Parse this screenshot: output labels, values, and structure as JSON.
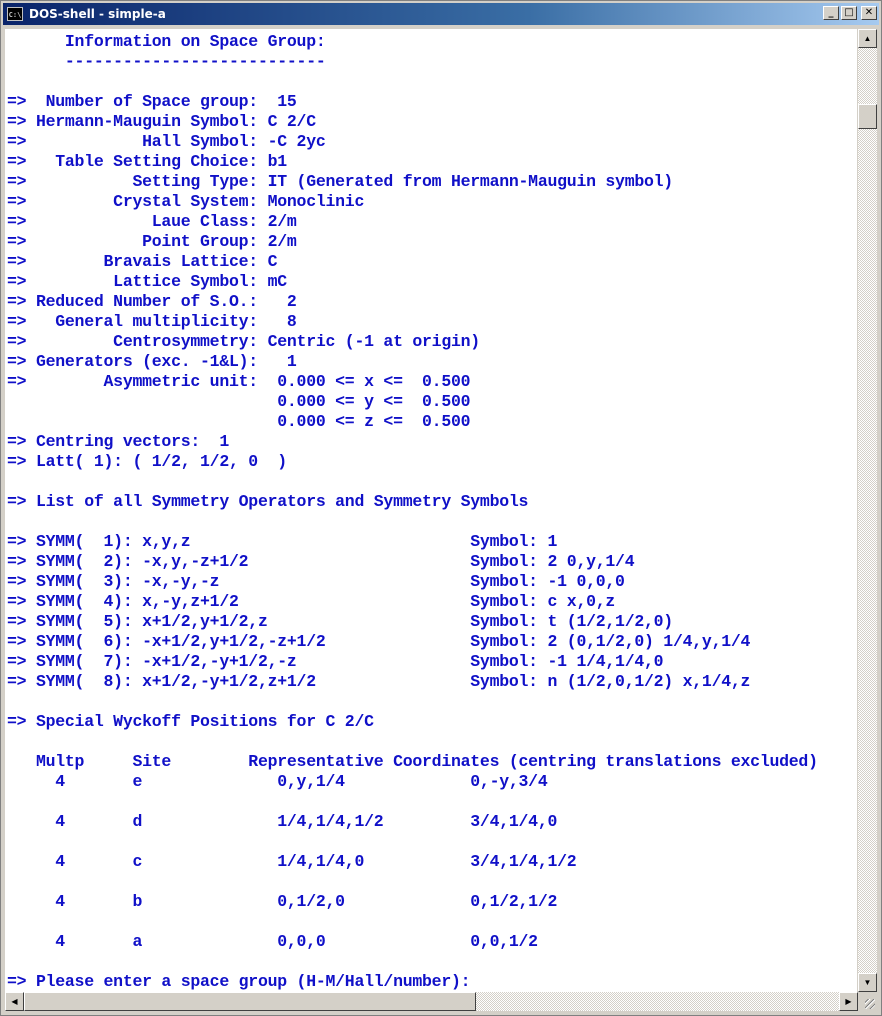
{
  "window": {
    "title": "DOS-shell - simple-a",
    "icon_label": "C:\\",
    "controls": {
      "minimize": "_",
      "maximize": "□",
      "close": "✕"
    }
  },
  "console": {
    "lines": [
      "      Information on Space Group:",
      "      ---------------------------",
      "",
      "=>  Number of Space group:  15",
      "=> Hermann-Mauguin Symbol: C 2/C",
      "=>            Hall Symbol: -C 2yc",
      "=>   Table Setting Choice: b1",
      "=>           Setting Type: IT (Generated from Hermann-Mauguin symbol)",
      "=>         Crystal System: Monoclinic",
      "=>             Laue Class: 2/m",
      "=>            Point Group: 2/m",
      "=>        Bravais Lattice: C",
      "=>         Lattice Symbol: mC",
      "=> Reduced Number of S.O.:   2",
      "=>   General multiplicity:   8",
      "=>         Centrosymmetry: Centric (-1 at origin)",
      "=> Generators (exc. -1&L):   1",
      "=>        Asymmetric unit:  0.000 <= x <=  0.500",
      "                            0.000 <= y <=  0.500",
      "                            0.000 <= z <=  0.500",
      "=> Centring vectors:  1",
      "=> Latt( 1): ( 1/2, 1/2, 0  )",
      "",
      "=> List of all Symmetry Operators and Symmetry Symbols",
      "",
      "=> SYMM(  1): x,y,z                             Symbol: 1",
      "=> SYMM(  2): -x,y,-z+1/2                       Symbol: 2 0,y,1/4",
      "=> SYMM(  3): -x,-y,-z                          Symbol: -1 0,0,0",
      "=> SYMM(  4): x,-y,z+1/2                        Symbol: c x,0,z",
      "=> SYMM(  5): x+1/2,y+1/2,z                     Symbol: t (1/2,1/2,0)",
      "=> SYMM(  6): -x+1/2,y+1/2,-z+1/2               Symbol: 2 (0,1/2,0) 1/4,y,1/4",
      "=> SYMM(  7): -x+1/2,-y+1/2,-z                  Symbol: -1 1/4,1/4,0",
      "=> SYMM(  8): x+1/2,-y+1/2,z+1/2                Symbol: n (1/2,0,1/2) x,1/4,z",
      "",
      "=> Special Wyckoff Positions for C 2/C",
      "",
      "   Multp     Site        Representative Coordinates (centring translations excluded)",
      "     4       e              0,y,1/4             0,-y,3/4",
      "",
      "     4       d              1/4,1/4,1/2         3/4,1/4,0",
      "",
      "     4       c              1/4,1/4,0           3/4,1/4,1/2",
      "",
      "     4       b              0,1/2,0             0,1/2,1/2",
      "",
      "     4       a              0,0,0               0,0,1/2",
      "",
      "=> Please enter a space group (H-M/Hall/number): "
    ]
  },
  "scrollbars": {
    "up_arrow": "▲",
    "down_arrow": "▼",
    "left_arrow": "◀",
    "right_arrow": "▶"
  }
}
